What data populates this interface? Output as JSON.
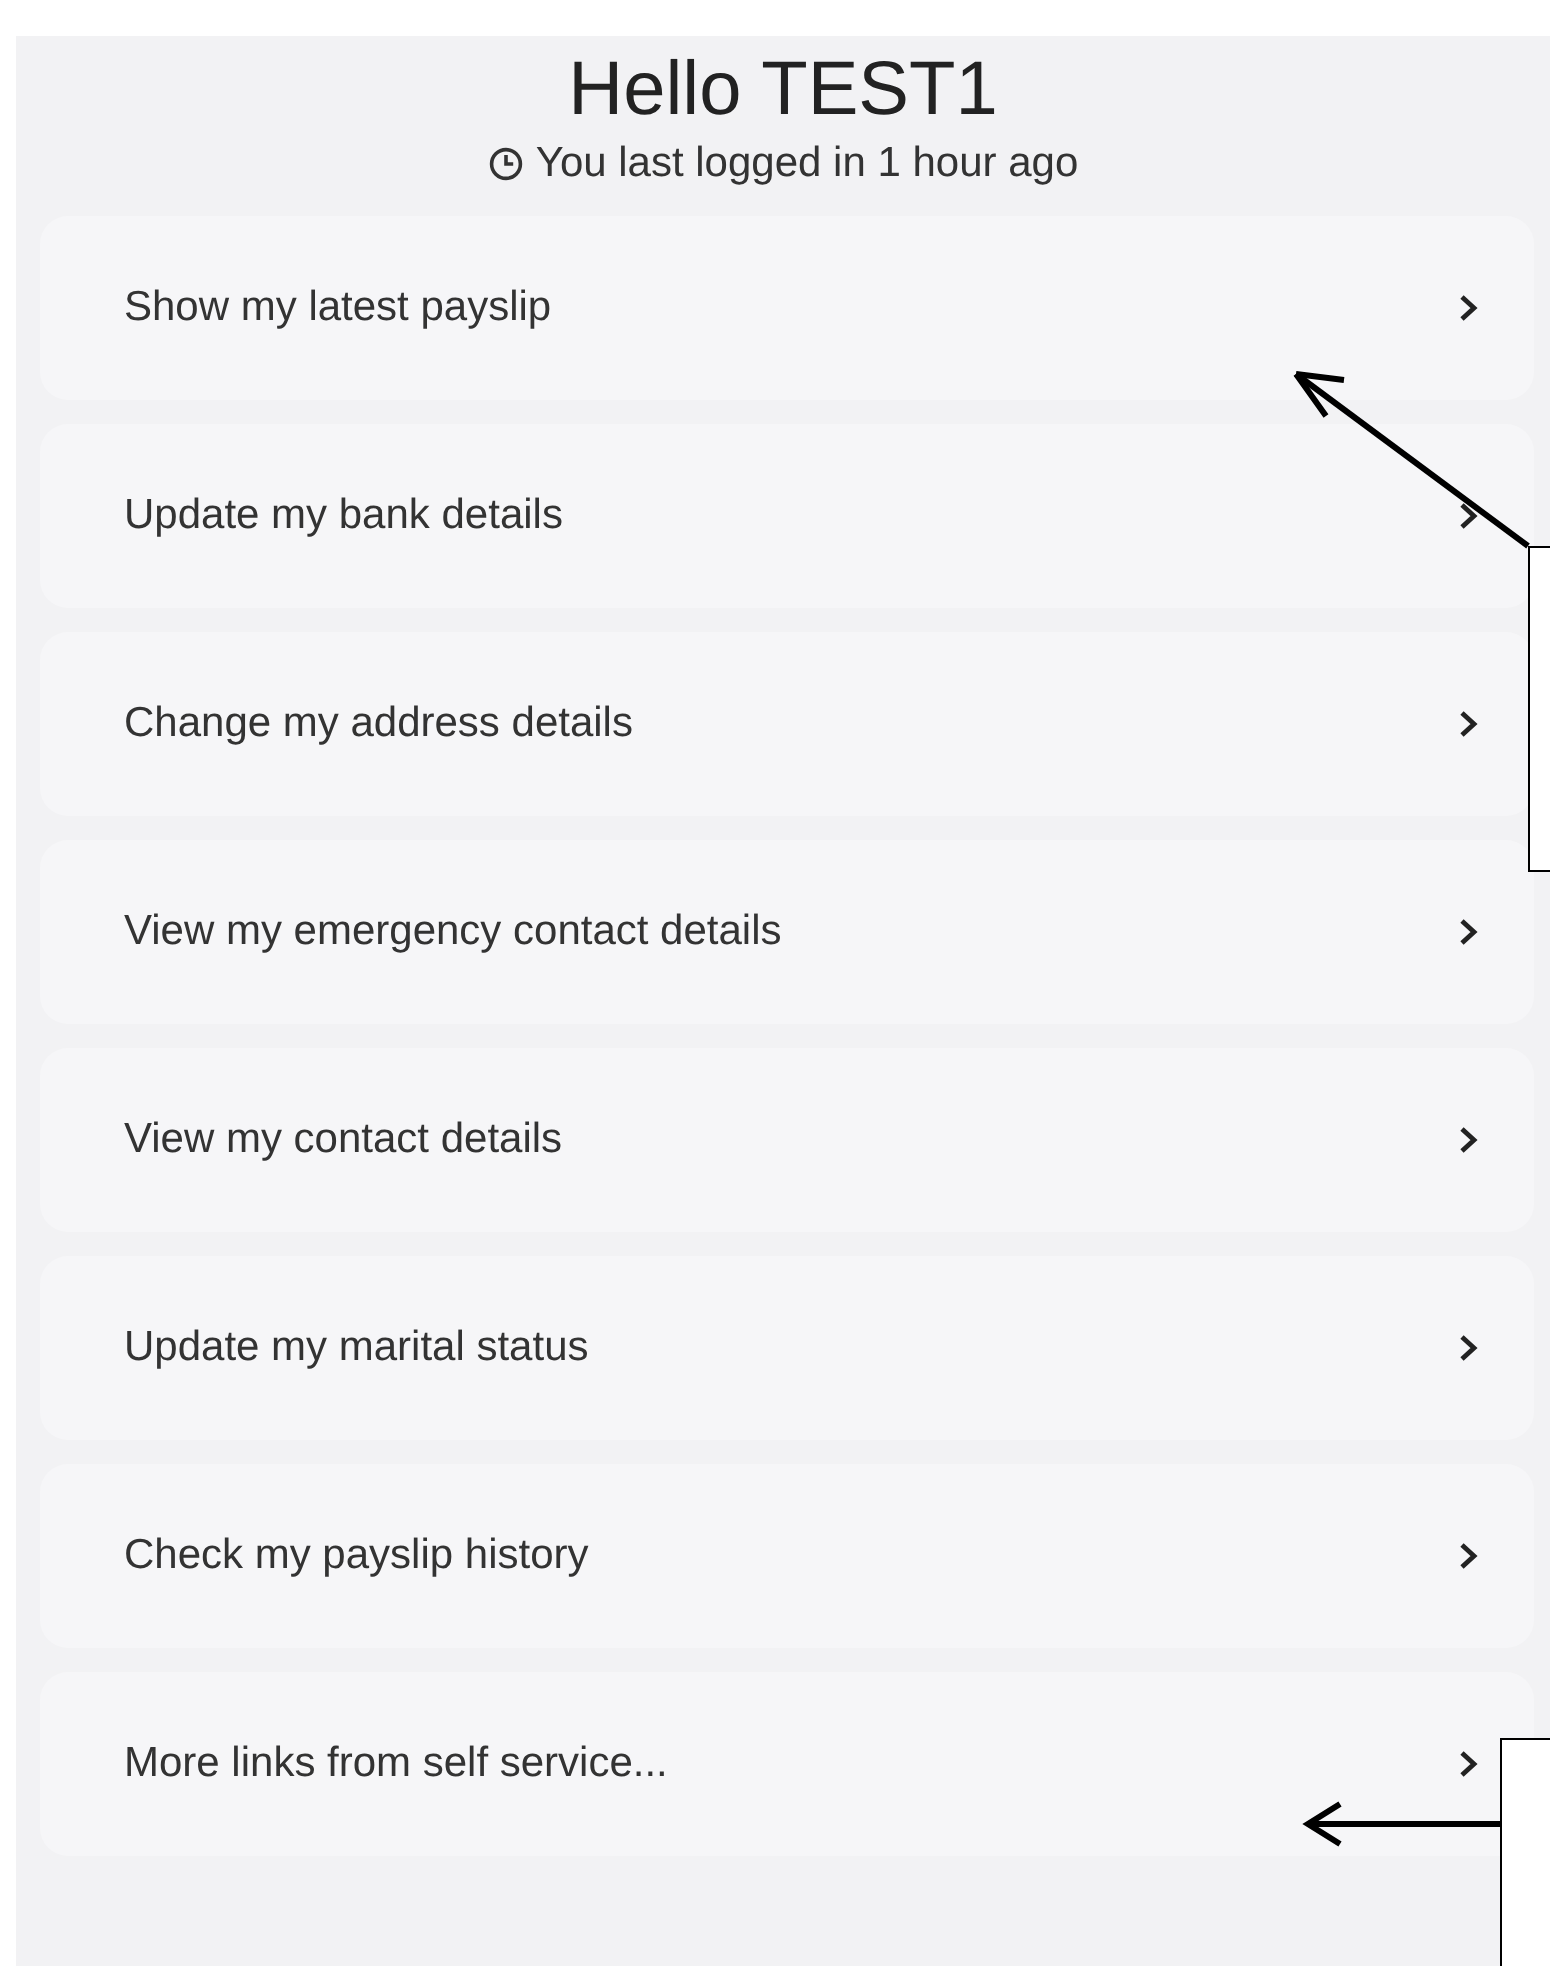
{
  "header": {
    "greeting": "Hello TEST1",
    "last_login": "You last logged in 1 hour ago"
  },
  "links": [
    {
      "label": "Show my latest payslip"
    },
    {
      "label": "Update my bank details"
    },
    {
      "label": "Change my address details"
    },
    {
      "label": "View my emergency contact details"
    },
    {
      "label": "View my contact details"
    },
    {
      "label": "Update my marital status"
    },
    {
      "label": "Check my payslip history"
    },
    {
      "label": "More links from self service..."
    }
  ]
}
